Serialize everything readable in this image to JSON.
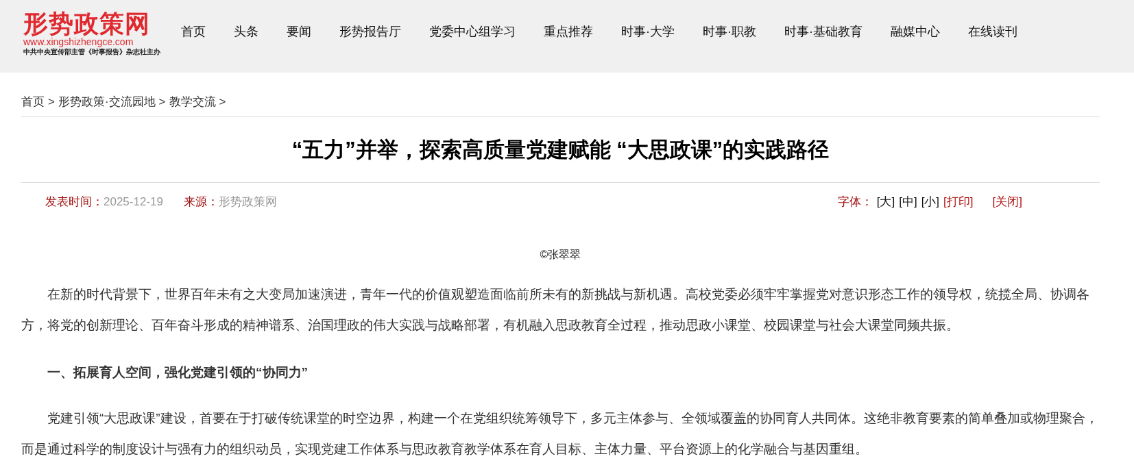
{
  "logo": {
    "name": "形势政策网",
    "url": "www.xingshizhengce.com",
    "tagline": "中共中央宣传部主管《时事报告》杂志社主办"
  },
  "nav": [
    "首页",
    "头条",
    "要闻",
    "形势报告厅",
    "党委中心组学习",
    "重点推荐",
    "时事·大学",
    "时事·职教",
    "时事·基础教育",
    "融媒中心",
    "在线读刊"
  ],
  "breadcrumb": [
    "首页",
    "形势政策·交流园地",
    "教学交流"
  ],
  "breadcrumb_separator": ">",
  "article": {
    "title": "“五力”并举，探索高质量党建赋能 “大思政课”的实践路径",
    "meta": {
      "date_label": "发表时间：",
      "date": "2025-12-19",
      "source_label": "来源：",
      "source": "形势政策网",
      "font_label": "字体：",
      "font_sizes": [
        "[大]",
        "[中]",
        "[小]"
      ],
      "print": "[打印]",
      "close": "[关闭]"
    },
    "author": "©张翠翠",
    "blocks": [
      {
        "kind": "paragraph",
        "text": "在新的时代背景下，世界百年未有之大变局加速演进，青年一代的价值观塑造面临前所未有的新挑战与新机遇。高校党委必须牢牢掌握党对意识形态工作的领导权，统揽全局、协调各方，将党的创新理论、百年奋斗形成的精神谱系、治国理政的伟大实践与战略部署，有机融入思政教育全过程，推动思政小课堂、校园课堂与社会大课堂同频共振。"
      },
      {
        "kind": "heading",
        "text": "一、拓展育人空间，强化党建引领的“协同力”"
      },
      {
        "kind": "paragraph",
        "text": "党建引领“大思政课”建设，首要在于打破传统课堂的时空边界，构建一个在党组织统筹领导下，多元主体参与、全领域覆盖的协同育人共同体。这绝非教育要素的简单叠加或物理聚合，而是通过科学的制度设计与强有力的组织动员，实现党建工作体系与思政教育教学体系在育人目标、主体力量、平台资源上的化学融合与基因重组。"
      }
    ]
  }
}
